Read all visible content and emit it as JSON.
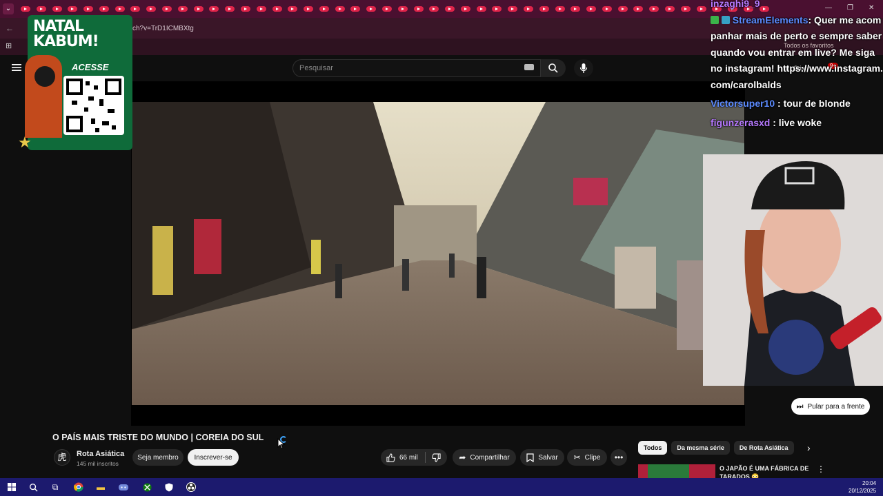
{
  "browser": {
    "url": "ch?v=TrD1ICMBXtg",
    "bookmarks_label": "Todos os favoritos"
  },
  "header": {
    "search_placeholder": "Pesquisar",
    "create_label": "Criar",
    "notifications_badge": "9+"
  },
  "promo": {
    "title_line1": "NATAL",
    "title_line2": "KABUM!",
    "cta": "ACESSE"
  },
  "chat": {
    "messages": [
      {
        "user": "inzaghi9_9",
        "text": "",
        "user_color": "#b77aff"
      },
      {
        "user": "StreamElements",
        "text": ": Quer me acompanhar mais de perto e sempre saber quando vou entrar em live? Me siga no instagram! https://www.instagram.com/carolbalds",
        "user_color": "#5c8bff"
      },
      {
        "user": "Victorsuper10",
        "text": " : tour de blonde",
        "user_color": "#5c8bff"
      },
      {
        "user": "figunzerasxd",
        "text": " : live woke",
        "user_color": "#b77aff"
      }
    ]
  },
  "video": {
    "skip_label": "Pular para a frente",
    "title": "O PAÍS MAIS TRISTE DO MUNDO | COREIA DO SUL",
    "channel": {
      "avatar_glyph": "虎",
      "name": "Rota Asiática",
      "subscribers": "145 mil inscritos"
    },
    "member_label": "Seja membro",
    "subscribe_label": "Inscrever-se",
    "likes": "66 mil",
    "share_label": "Compartilhar",
    "save_label": "Salvar",
    "clip_label": "Clipe"
  },
  "related": {
    "chips": [
      "Todos",
      "Da mesma série",
      "De Rota Asiática"
    ],
    "first_title": "O JAPÃO É UMA FÁBRICA DE TARADOS 😳"
  },
  "taskbar": {
    "time": "20:04",
    "date": "20/12/2025"
  },
  "colors": {
    "tab_accent": "#e0244a",
    "promo_green": "#0f6b3a",
    "taskbar": "#1c1a6e"
  }
}
